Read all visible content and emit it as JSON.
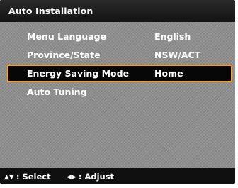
{
  "menu": {
    "title": "Auto Installation",
    "items": [
      {
        "label": "Menu Language",
        "value": "English",
        "selected": false
      },
      {
        "label": "Province/State",
        "value": "NSW/ACT",
        "selected": false
      },
      {
        "label": "Energy Saving Mode",
        "value": "Home",
        "selected": true
      },
      {
        "label": "Auto Tuning",
        "value": "",
        "selected": false
      }
    ]
  },
  "footer": {
    "select_icon": "▲▼",
    "select_text": ": Select",
    "adjust_icon": "◀▶",
    "adjust_text": ": Adjust"
  },
  "colors": {
    "highlight_border": "#f0a030",
    "title_bar": "#1c1c1c",
    "menu_background": "#8f8f8f",
    "text": "#ffffff"
  },
  "icons": {
    "select": "up-down-arrows-icon",
    "adjust": "left-right-arrows-icon"
  }
}
